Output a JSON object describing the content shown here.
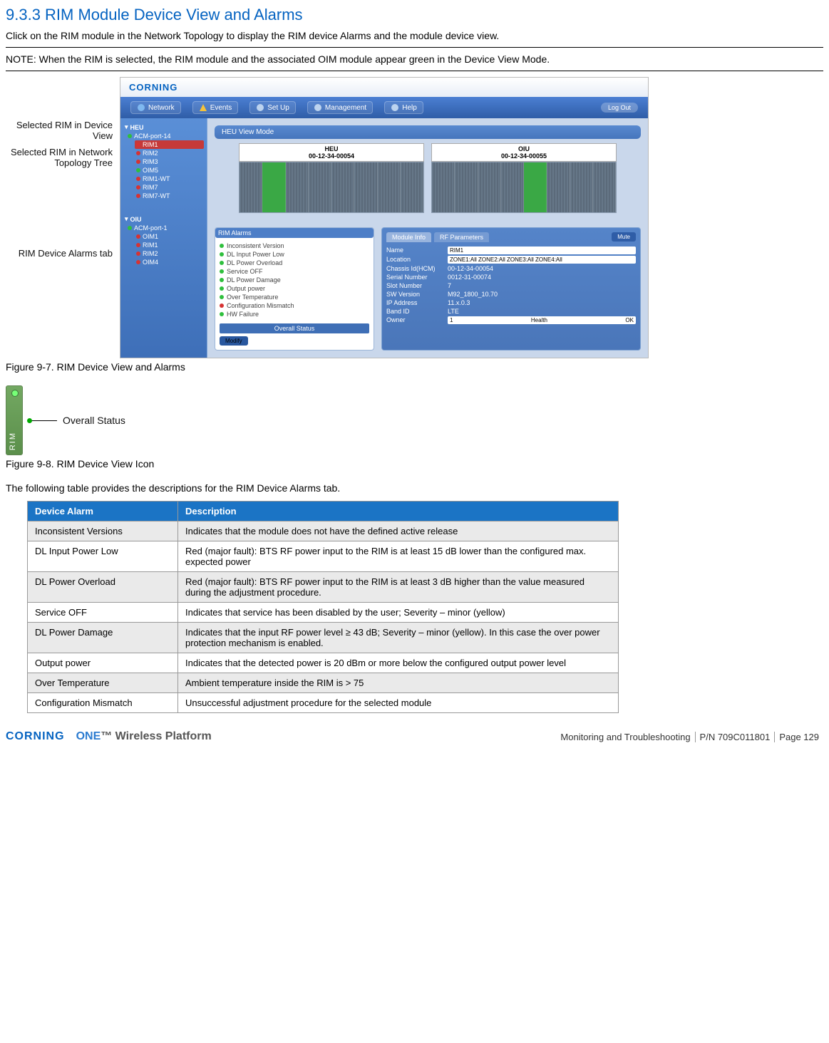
{
  "section_heading": "9.3.3 RIM Module Device View and Alarms",
  "intro": "Click on the RIM module in the Network Topology to display the RIM device Alarms and the module device view.",
  "note": "NOTE: When the RIM is selected, the RIM module and the associated OIM module appear green in the Device View Mode.",
  "fig1_caption": "Figure 9-7. RIM Device View and Alarms",
  "fig2_caption": "Figure 9-8. RIM Device View Icon",
  "table_intro": "The following table provides the descriptions for the RIM Device Alarms tab.",
  "callouts": {
    "c1": "Selected RIM in Device View",
    "c2": "Selected RIM in Network Topology Tree",
    "c3": "RIM Device Alarms tab"
  },
  "app": {
    "brand": "CORNING",
    "toolbar": {
      "t1": "Network",
      "t2": "Events",
      "t3": "Set Up",
      "t4": "Management",
      "t5": "Help",
      "logout": "Log Out"
    },
    "titlebar": "HEU View Mode",
    "rack1": {
      "label": "HEU",
      "serial": "00-12-34-00054"
    },
    "rack2": {
      "label": "OIU",
      "serial": "00-12-34-00055"
    },
    "tree": {
      "root": "HEU",
      "n1": "ACM-port-14",
      "n2": "RIM1",
      "n3": "RIM2",
      "n4": "RIM3",
      "n5": "OIM5",
      "n6": "RIM1-WT",
      "n7": "RIM7",
      "n8": "RIM7-WT",
      "sep": "OIU",
      "m1": "ACM-port-1",
      "m2": "OIM1",
      "m3": "RIM1",
      "m4": "RIM2",
      "m5": "OIM4"
    },
    "alarms_header": "RIM Alarms",
    "alarm_items": {
      "a1": "Inconsistent Version",
      "a2": "DL Input Power Low",
      "a3": "DL Power Overload",
      "a4": "Service OFF",
      "a5": "DL Power Damage",
      "a6": "Output power",
      "a7": "Over Temperature",
      "a8": "Configuration Mismatch",
      "a9": "HW Failure"
    },
    "overall_status_label": "Overall Status",
    "modify": "Modify",
    "props": {
      "tab1": "Module Info",
      "tab2": "RF Parameters",
      "mute": "Mute",
      "k_name": "Name",
      "v_name": "RIM1",
      "k_loc": "Location",
      "v_loc": "ZONE1:All ZONE2:All ZONE3:All ZONE4:All",
      "k_cm": "Chassis Id(HCM)",
      "v_cm": "00-12-34-00054",
      "k_sn": "Serial Number",
      "v_sn": "0012-31-00074",
      "k_slot": "Slot Number",
      "v_slot": "7",
      "k_sw": "SW Version",
      "v_sw": "M92_1800_10.70",
      "k_ip": "IP Address",
      "v_ip": "11.x.0.3",
      "k_band": "Band ID",
      "v_band": "LTE",
      "k_owner": "Owner",
      "v_owner": "1",
      "health_lbl": "Health",
      "health_val": "OK"
    }
  },
  "icon_fig": {
    "rim_text": "RIM",
    "overall": "Overall Status"
  },
  "table": {
    "h1": "Device Alarm",
    "h2": "Description",
    "rows": {
      "r1a": "Inconsistent Versions",
      "r1b": "Indicates that the module does not have the defined active release",
      "r2a": "DL Input Power Low",
      "r2b": "Red (major fault): BTS RF power input to the RIM is at least 15 dB lower than the configured max. expected power",
      "r3a": "DL Power Overload",
      "r3b": "Red (major fault): BTS RF power input to the RIM is at least 3 dB higher than the value measured during the adjustment procedure.",
      "r4a": "Service OFF",
      "r4b": "Indicates that service has been disabled by the user; Severity – minor (yellow)",
      "r5a": "DL Power Damage",
      "r5b": "Indicates that the input RF power level ≥ 43 dB; Severity – minor (yellow). In this case the over power protection mechanism is enabled.",
      "r6a": "Output power",
      "r6b": "Indicates that the detected power is 20 dBm or more below the configured output power level",
      "r7a": "Over Temperature",
      "r7b": "Ambient temperature inside the RIM is > 75",
      "r8a": "Configuration Mismatch",
      "r8b": "Unsuccessful adjustment procedure for the selected module"
    }
  },
  "footer": {
    "corning": "CORNING",
    "one": "ONE",
    "one_suffix": " Wireless Platform",
    "sect": "Monitoring and Troubleshooting",
    "pn": "P/N 709C011801",
    "page": "Page 129"
  }
}
